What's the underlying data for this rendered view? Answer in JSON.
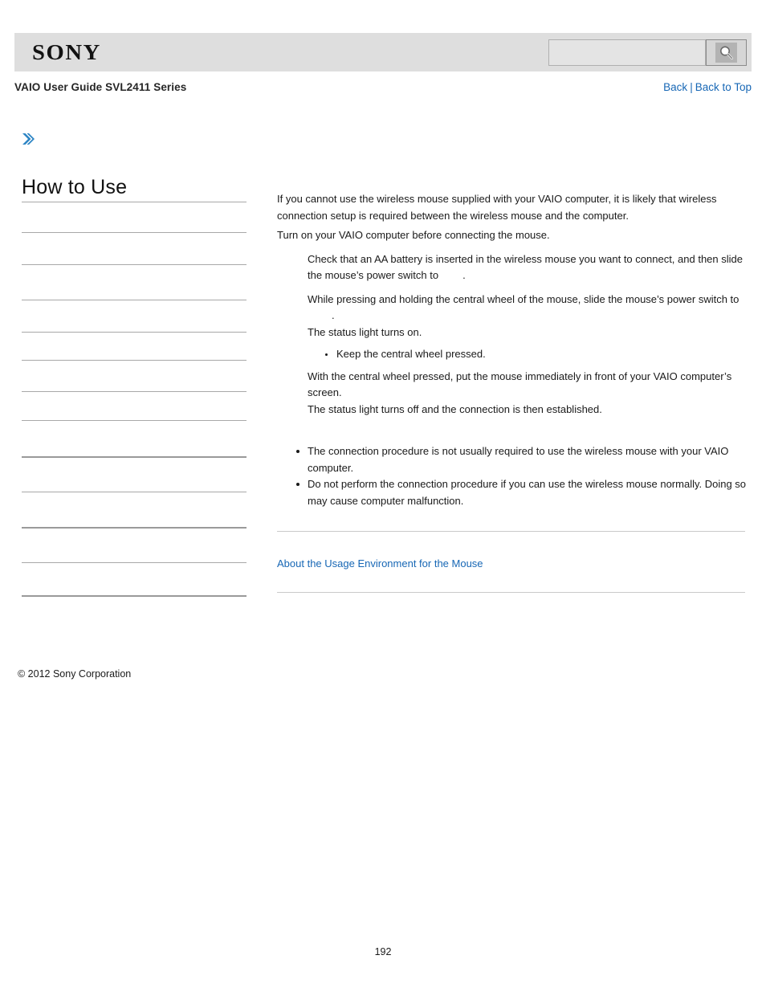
{
  "header": {
    "brand_logo_text": "SONY",
    "search": {
      "value": "",
      "placeholder": "",
      "button_icon": "search-icon"
    }
  },
  "subheader": {
    "guide_title": "VAIO User Guide SVL2411 Series",
    "nav": {
      "back_label": "Back",
      "separator": "|",
      "back_to_top_label": "Back to Top"
    }
  },
  "marker": {
    "chevron_icon": "double-chevron-right-icon",
    "chevron_glyph": "❯",
    "color": "#2b84c4"
  },
  "sidebar": {
    "title": "How to Use",
    "items": [
      {
        "label": "",
        "thick": false
      },
      {
        "label": "",
        "thick": false
      },
      {
        "label": "",
        "thick": false
      },
      {
        "label": "",
        "thick": false
      },
      {
        "label": "",
        "thick": false
      },
      {
        "label": "",
        "thick": false
      },
      {
        "label": "",
        "thick": false
      },
      {
        "label": "",
        "thick": false
      },
      {
        "label": "",
        "thick": true
      },
      {
        "label": "",
        "thick": false
      },
      {
        "label": "",
        "thick": true
      },
      {
        "label": "",
        "thick": false
      },
      {
        "label": "",
        "thick": true
      }
    ]
  },
  "content": {
    "intro_lines": [
      "If you cannot use the wireless mouse supplied with your VAIO computer, it is likely that wireless connection setup is required between the wireless mouse and the computer.",
      "Turn on your VAIO computer before connecting the mouse."
    ],
    "intro_line_1": "If you cannot use the wireless mouse supplied with your VAIO computer, it is likely that wireless connection setup is required between the wireless mouse and the computer.",
    "intro_line_2": "Turn on your VAIO computer before connecting the mouse.",
    "step_1_a": "Check that an AA battery is inserted in the wireless mouse you want to connect, and then slide the mouse’s power switch to",
    "step_1_b": ".",
    "step_2_a": "While pressing and holding the central wheel of the mouse, slide the mouse’s power switch to",
    "step_2_b": ".",
    "step_2_c": "The status light turns on.",
    "step_2_sub_bullet": "Keep the central wheel pressed.",
    "step_3_a": "With the central wheel pressed, put the mouse immediately in front of your VAIO computer’s screen.",
    "step_3_b": "The status light turns off and the connection is then established.",
    "notes": [
      "The connection procedure is not usually required to use the wireless mouse with your VAIO computer.",
      "Do not perform the connection procedure if you can use the wireless mouse normally. Doing so may cause computer malfunction."
    ],
    "related_link": "About the Usage Environment for the Mouse"
  },
  "footer": {
    "copyright": "© 2012 Sony Corporation",
    "page_number": "192"
  },
  "colors": {
    "link": "#1767b5",
    "header_band": "#dedede",
    "accent": "#2b84c4"
  }
}
